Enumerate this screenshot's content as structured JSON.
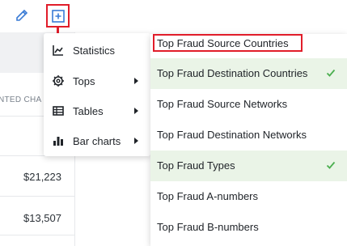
{
  "toolbar": {
    "edit_icon": "pencil-icon",
    "add_icon": "plus-square-icon"
  },
  "table": {
    "column_header": "NTED CHA",
    "values": [
      "$21,223",
      "$13,507"
    ]
  },
  "menu": {
    "items": [
      {
        "label": "Statistics",
        "icon": "line-chart-icon",
        "has_submenu": false
      },
      {
        "label": "Tops",
        "icon": "gear-icon",
        "has_submenu": true
      },
      {
        "label": "Tables",
        "icon": "table-icon",
        "has_submenu": true
      },
      {
        "label": "Bar charts",
        "icon": "bar-chart-icon",
        "has_submenu": true
      }
    ]
  },
  "submenu": {
    "items": [
      {
        "label": "Top Fraud Source Countries",
        "selected": false
      },
      {
        "label": "Top Fraud Destination Countries",
        "selected": true
      },
      {
        "label": "Top Fraud Source Networks",
        "selected": false
      },
      {
        "label": "Top Fraud Destination Networks",
        "selected": false
      },
      {
        "label": "Top Fraud Types",
        "selected": true
      },
      {
        "label": "Top Fraud A-numbers",
        "selected": false
      },
      {
        "label": "Top Fraud B-numbers",
        "selected": false
      }
    ]
  },
  "colors": {
    "accent": "#3a7bd5",
    "annotation": "#e11d2a",
    "selected_bg": "#eaf4e7",
    "check": "#4caf50"
  }
}
